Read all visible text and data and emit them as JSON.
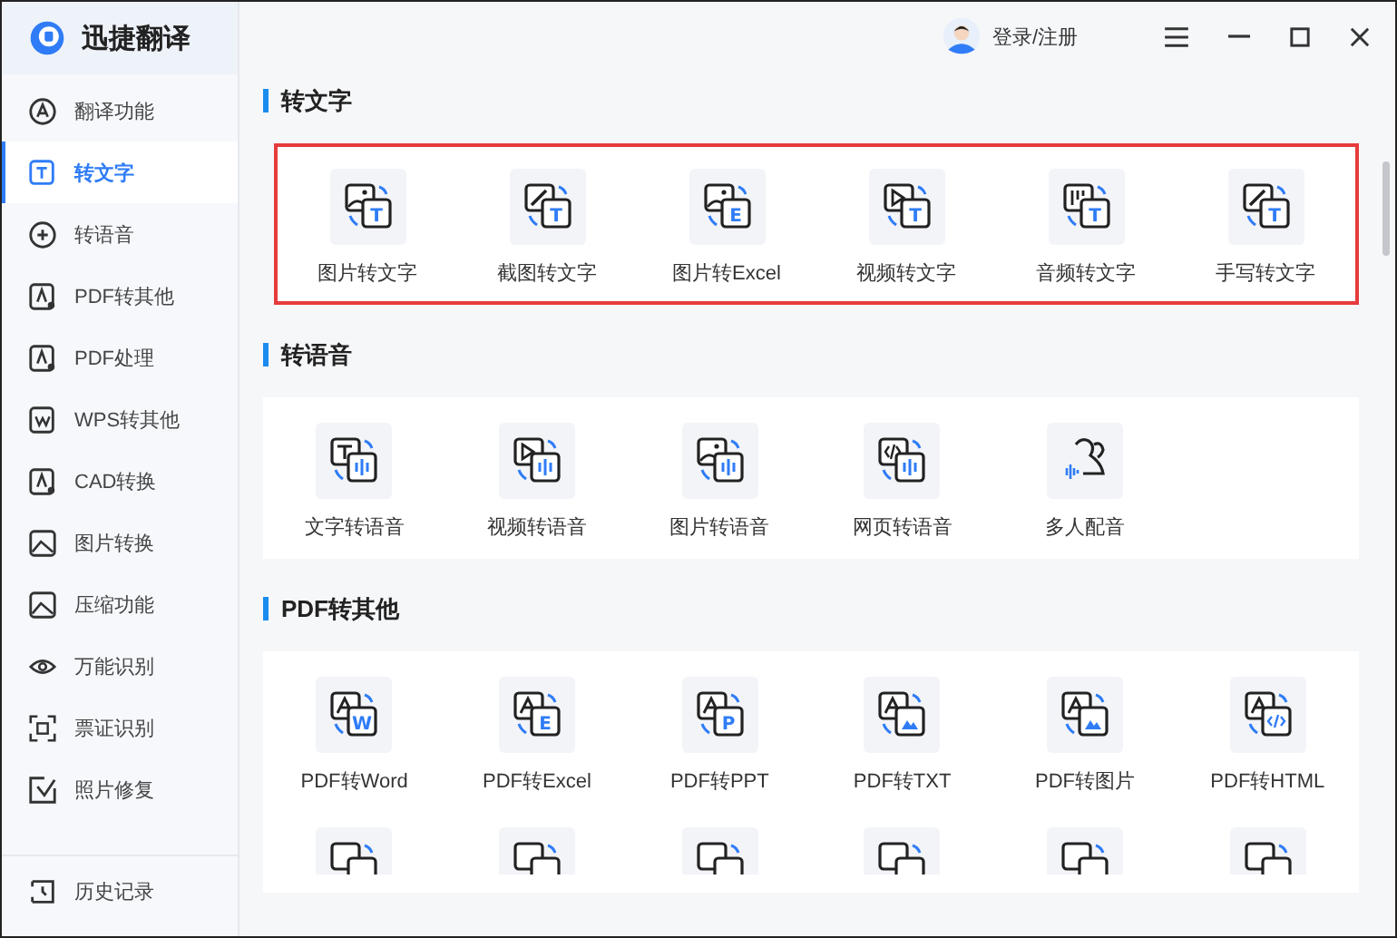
{
  "app": {
    "name": "迅捷翻译"
  },
  "sidebar": {
    "items": [
      {
        "label": "翻译功能",
        "selected": false
      },
      {
        "label": "转文字",
        "selected": true
      },
      {
        "label": "转语音",
        "selected": false
      },
      {
        "label": "PDF转其他",
        "selected": false
      },
      {
        "label": "PDF处理",
        "selected": false
      },
      {
        "label": "WPS转其他",
        "selected": false
      },
      {
        "label": "CAD转换",
        "selected": false
      },
      {
        "label": "图片转换",
        "selected": false
      },
      {
        "label": "压缩功能",
        "selected": false
      },
      {
        "label": "万能识别",
        "selected": false
      },
      {
        "label": "票证识别",
        "selected": false
      },
      {
        "label": "照片修复",
        "selected": false
      }
    ],
    "footer": {
      "label": "历史记录"
    }
  },
  "topbar": {
    "login": "登录/注册"
  },
  "sections": [
    {
      "title": "转文字",
      "highlighted": true,
      "tiles": [
        {
          "label": "图片转文字",
          "badge": "T"
        },
        {
          "label": "截图转文字",
          "badge": "T"
        },
        {
          "label": "图片转Excel",
          "badge": "E"
        },
        {
          "label": "视频转文字",
          "badge": "T"
        },
        {
          "label": "音频转文字",
          "badge": "T"
        },
        {
          "label": "手写转文字",
          "badge": "T"
        }
      ]
    },
    {
      "title": "转语音",
      "highlighted": false,
      "tiles": [
        {
          "label": "文字转语音"
        },
        {
          "label": "视频转语音"
        },
        {
          "label": "图片转语音"
        },
        {
          "label": "网页转语音"
        },
        {
          "label": "多人配音"
        }
      ]
    },
    {
      "title": "PDF转其他",
      "highlighted": false,
      "tiles": [
        {
          "label": "PDF转Word",
          "badge": "W"
        },
        {
          "label": "PDF转Excel",
          "badge": "E"
        },
        {
          "label": "PDF转PPT",
          "badge": "P"
        },
        {
          "label": "PDF转TXT"
        },
        {
          "label": "PDF转图片"
        },
        {
          "label": "PDF转HTML"
        }
      ]
    }
  ]
}
